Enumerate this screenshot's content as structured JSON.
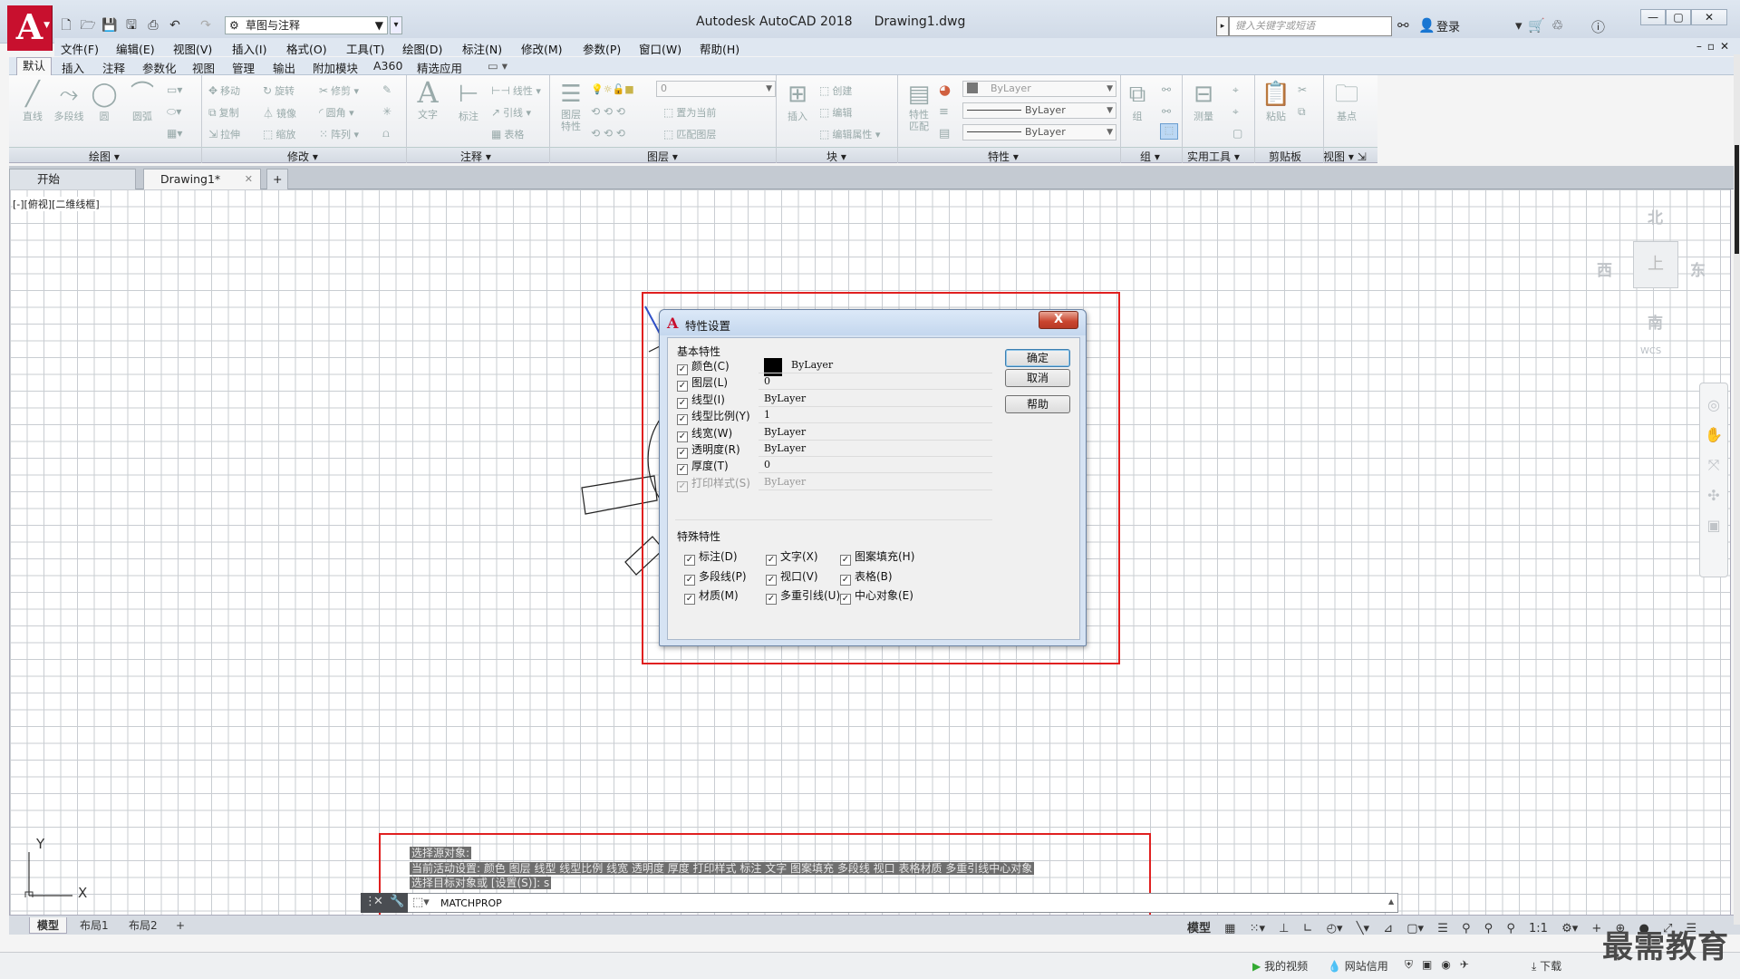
{
  "titlebar": {
    "app_title": "Autodesk AutoCAD 2018",
    "doc_title": "Drawing1.dwg",
    "workspace": "草图与注释",
    "search_placeholder": "键入关键字或短语",
    "login": "登录"
  },
  "menu": [
    "文件(F)",
    "编辑(E)",
    "视图(V)",
    "插入(I)",
    "格式(O)",
    "工具(T)",
    "绘图(D)",
    "标注(N)",
    "修改(M)",
    "参数(P)",
    "窗口(W)",
    "帮助(H)"
  ],
  "ribbon_tabs": [
    "默认",
    "插入",
    "注释",
    "参数化",
    "视图",
    "管理",
    "输出",
    "附加模块",
    "A360",
    "精选应用"
  ],
  "ribbon": {
    "draw": {
      "line": "直线",
      "pline": "多段线",
      "circle": "圆",
      "arc": "圆弧"
    },
    "modify": {
      "move": "移动",
      "rotate": "旋转",
      "trim": "修剪",
      "copy": "复制",
      "mirror": "镜像",
      "fillet": "圆角",
      "stretch": "拉伸",
      "scale": "缩放",
      "array": "阵列"
    },
    "annotation": {
      "text": "文字",
      "dim": "标注",
      "linear": "线性",
      "leader": "引线",
      "table": "表格"
    },
    "layers": {
      "props": "图层特性",
      "current_layer": "0",
      "set_current": "置为当前",
      "match": "匹配图层"
    },
    "block": {
      "insert": "插入",
      "create": "创建",
      "edit": "编辑",
      "edit_attr": "编辑属性"
    },
    "properties": {
      "match": "特性匹配",
      "color": "ByLayer",
      "linetype": "ByLayer",
      "lineweight": "ByLayer"
    },
    "group": {
      "label": "组"
    },
    "utilities": {
      "measure": "测量"
    },
    "clipboard": {
      "paste": "粘贴"
    },
    "view": {
      "base": "基点"
    },
    "panel_labels": [
      "绘图",
      "修改",
      "注释",
      "图层",
      "块",
      "特性",
      "组",
      "实用工具",
      "剪贴板",
      "视图"
    ]
  },
  "doc_tabs": [
    {
      "label": "开始"
    },
    {
      "label": "Drawing1*"
    }
  ],
  "viewport_label": "[-][俯视][二维线框]",
  "viewcube": {
    "north": "北",
    "south": "南",
    "east": "东",
    "west": "西",
    "top": "上",
    "wcs": "WCS"
  },
  "ucs": {
    "x": "X",
    "y": "Y"
  },
  "dialog": {
    "title": "特性设置",
    "close": "X",
    "basic_group": "基本特性",
    "basic": [
      {
        "label": "颜色(C)",
        "value": "ByLayer",
        "checked": true
      },
      {
        "label": "图层(L)",
        "value": "0",
        "checked": true
      },
      {
        "label": "线型(I)",
        "value": "ByLayer",
        "checked": true
      },
      {
        "label": "线型比例(Y)",
        "value": "1",
        "checked": true
      },
      {
        "label": "线宽(W)",
        "value": "ByLayer",
        "checked": true
      },
      {
        "label": "透明度(R)",
        "value": "ByLayer",
        "checked": true
      },
      {
        "label": "厚度(T)",
        "value": "0",
        "checked": true
      },
      {
        "label": "打印样式(S)",
        "value": "ByLayer",
        "checked": true,
        "disabled": true
      }
    ],
    "special_group": "特殊特性",
    "special": [
      {
        "label": "标注(D)",
        "checked": true
      },
      {
        "label": "文字(X)",
        "checked": true
      },
      {
        "label": "图案填充(H)",
        "checked": true
      },
      {
        "label": "多段线(P)",
        "checked": true
      },
      {
        "label": "视口(V)",
        "checked": true
      },
      {
        "label": "表格(B)",
        "checked": true
      },
      {
        "label": "材质(M)",
        "checked": true
      },
      {
        "label": "多重引线(U)",
        "checked": true
      },
      {
        "label": "中心对象(E)",
        "checked": true
      }
    ],
    "buttons": {
      "ok": "确定",
      "cancel": "取消",
      "help": "帮助"
    }
  },
  "command": {
    "history": [
      "选择源对象:",
      "当前活动设置: 颜色 图层 线型 线型比例 线宽 透明度 厚度 打印样式 标注 文字 图案填充 多段线 视口 表格材质 多重引线中心对象",
      "选择目标对象或 [设置(S)]: s"
    ],
    "input": "MATCHPROP"
  },
  "layout_tabs": [
    "模型",
    "布局1",
    "布局2"
  ],
  "status": {
    "model": "模型",
    "scale": "1:1"
  },
  "os_bar": {
    "my_video": "我的视频",
    "net": "网站信用",
    "download": "下载"
  },
  "watermark": "最需教育"
}
